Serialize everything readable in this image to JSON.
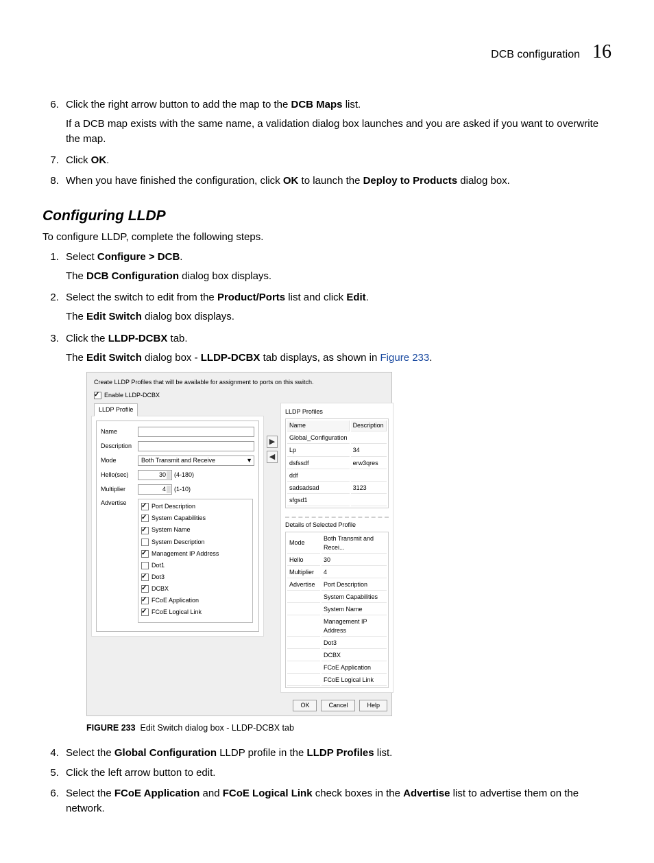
{
  "header": {
    "title": "DCB configuration",
    "chapter": "16"
  },
  "steps_a": [
    {
      "num": "6",
      "text_prefix": "Click the right arrow button to add the map to the ",
      "bold1": "DCB Maps",
      "text_suffix": " list.",
      "para": "If a DCB map exists with the same name, a validation dialog box launches and you are asked if you want to overwrite the map."
    },
    {
      "num": "7",
      "text_prefix": "Click ",
      "bold1": "OK",
      "text_suffix": "."
    },
    {
      "num": "8",
      "text_prefix": "When you have finished the configuration, click ",
      "bold1": "OK",
      "text_mid": " to launch the ",
      "bold2": "Deploy to Products",
      "text_suffix": " dialog box."
    }
  ],
  "section_title": "Configuring LLDP",
  "intro": "To configure LLDP, complete the following steps.",
  "steps_b": [
    {
      "num": "1",
      "line1_pre": "Select ",
      "line1_b": "Configure > DCB",
      "line1_post": ".",
      "line2_pre": "The ",
      "line2_b": "DCB Configuration",
      "line2_post": " dialog box displays."
    },
    {
      "num": "2",
      "line1_pre": "Select the switch to edit from the ",
      "line1_b": "Product/Ports",
      "line1_mid": " list and click ",
      "line1_b2": "Edit",
      "line1_post": ".",
      "line2_pre": "The ",
      "line2_b": "Edit Switch",
      "line2_post": " dialog box displays."
    },
    {
      "num": "3",
      "line1_pre": "Click the ",
      "line1_b": "LLDP-DCBX",
      "line1_post": " tab.",
      "line2_pre": "The ",
      "line2_b": "Edit Switch",
      "line2_mid": " dialog box - ",
      "line2_b2": "LLDP-DCBX",
      "line2_mid2": " tab displays, as shown in ",
      "line2_link": "Figure 233",
      "line2_post": "."
    }
  ],
  "dialog": {
    "header_text": "Create LLDP Profiles that will be available for assignment to ports on this switch.",
    "enable_label": "Enable LLDP-DCBX",
    "tab_label": "LLDP Profile",
    "form": {
      "name_label": "Name",
      "desc_label": "Description",
      "mode_label": "Mode",
      "mode_value": "Both Transmit and Receive",
      "hello_label": "Hello(sec)",
      "hello_value": "30",
      "hello_hint": "(4-180)",
      "mult_label": "Multiplier",
      "mult_value": "4",
      "mult_hint": "(1-10)",
      "adv_label": "Advertise"
    },
    "advertise": [
      {
        "label": "Port Description",
        "checked": true
      },
      {
        "label": "System Capabilities",
        "checked": true
      },
      {
        "label": "System Name",
        "checked": true
      },
      {
        "label": "System Description",
        "checked": false
      },
      {
        "label": "Management IP Address",
        "checked": true
      },
      {
        "label": "Dot1",
        "checked": false
      },
      {
        "label": "Dot3",
        "checked": true
      },
      {
        "label": "DCBX",
        "checked": true
      },
      {
        "label": "FCoE Application",
        "checked": true
      },
      {
        "label": "FCoE Logical Link",
        "checked": true
      }
    ],
    "right_title": "LLDP Profiles",
    "profiles_headers": {
      "name": "Name",
      "desc": "Description"
    },
    "profiles": [
      {
        "name": "Global_Configuration",
        "desc": ""
      },
      {
        "name": "Lp",
        "desc": "34"
      },
      {
        "name": "dsfssdf",
        "desc": "erw3qres"
      },
      {
        "name": "ddf",
        "desc": ""
      },
      {
        "name": "sadsadsad",
        "desc": "3123"
      },
      {
        "name": "sfgsd1",
        "desc": ""
      }
    ],
    "details_title": "Details of Selected Profile",
    "details": [
      {
        "k": "Mode",
        "v": "Both Transmit and Recei..."
      },
      {
        "k": "Hello",
        "v": "30"
      },
      {
        "k": "Multiplier",
        "v": "4"
      },
      {
        "k": "Advertise",
        "v": "Port Description"
      },
      {
        "k": "",
        "v": "System Capabilities"
      },
      {
        "k": "",
        "v": "System Name"
      },
      {
        "k": "",
        "v": "Management IP Address"
      },
      {
        "k": "",
        "v": "Dot3"
      },
      {
        "k": "",
        "v": "DCBX"
      },
      {
        "k": "",
        "v": "FCoE Application"
      },
      {
        "k": "",
        "v": "FCoE Logical Link"
      }
    ],
    "buttons": {
      "ok": "OK",
      "cancel": "Cancel",
      "help": "Help"
    }
  },
  "figure": {
    "label": "FIGURE 233",
    "caption": "Edit Switch dialog box - LLDP-DCBX tab"
  },
  "steps_c": [
    {
      "num": "4",
      "pre": "Select the ",
      "b1": "Global Configuration",
      "mid": " LLDP profile in the ",
      "b2": "LLDP Profiles",
      "post": " list."
    },
    {
      "num": "5",
      "text": "Click the left arrow button to edit."
    },
    {
      "num": "6",
      "pre": "Select the ",
      "b1": "FCoE Application",
      "mid": " and ",
      "b2": "FCoE Logical Link",
      "mid2": " check boxes in the ",
      "b3": "Advertise",
      "post": " list to advertise them on the network."
    }
  ]
}
